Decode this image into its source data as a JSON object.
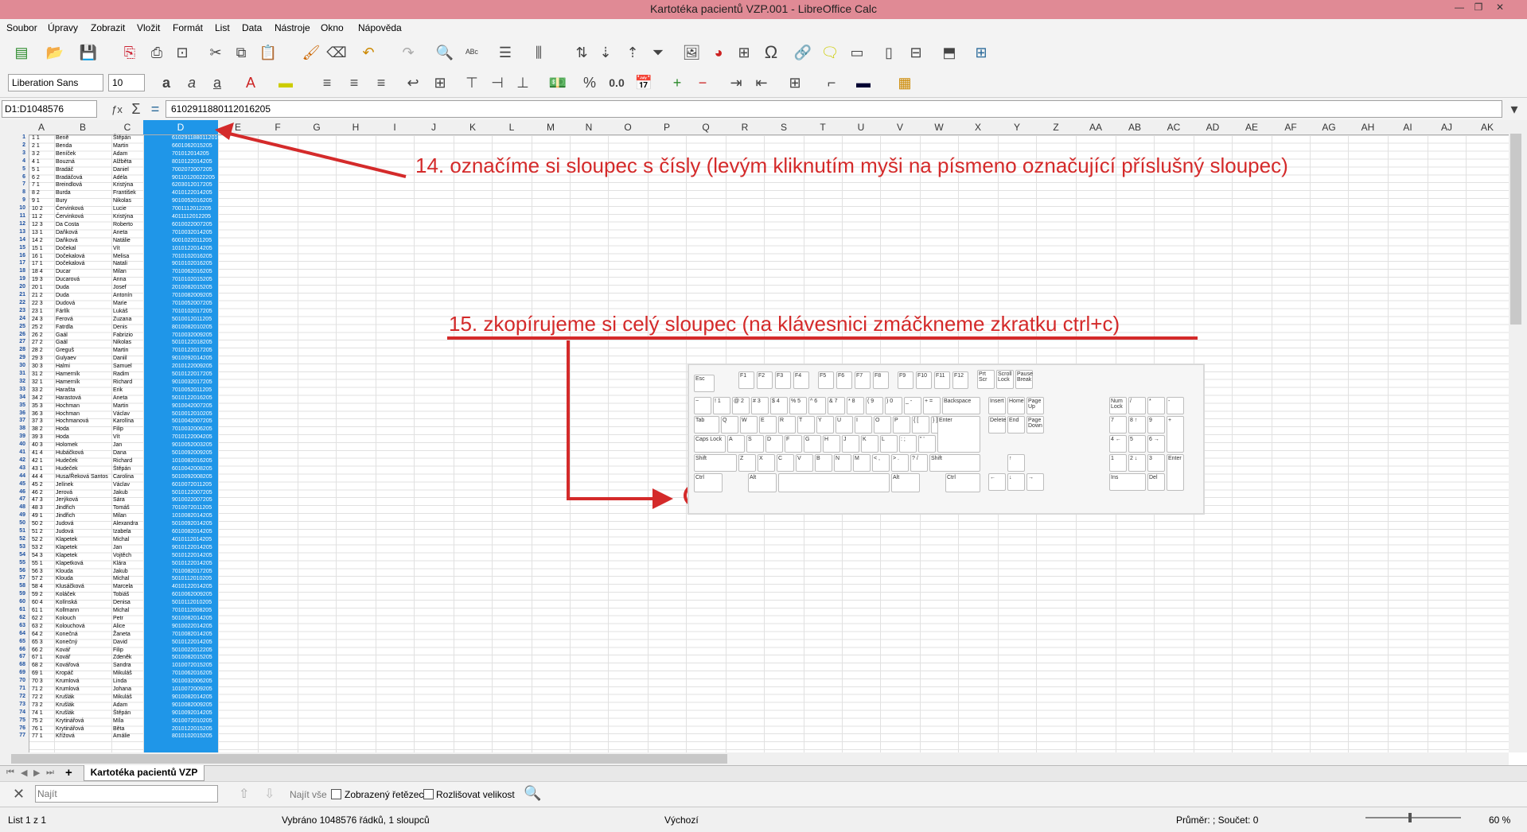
{
  "window": {
    "title": "Kartotéka pacientů VZP.001 - LibreOffice Calc"
  },
  "menu": [
    "Soubor",
    "Úpravy",
    "Zobrazit",
    "Vložit",
    "Formát",
    "List",
    "Data",
    "Nástroje",
    "Okno",
    "Nápověda"
  ],
  "toolbar": {
    "font_name": "Liberation Sans",
    "font_size": "10"
  },
  "formula_bar": {
    "name_box": "D1:D1048576",
    "content": "6102911880112016205"
  },
  "columns": [
    "A",
    "B",
    "C",
    "D",
    "E",
    "F",
    "G",
    "H",
    "I",
    "J",
    "K",
    "L",
    "M",
    "N",
    "O",
    "P",
    "Q",
    "R",
    "S",
    "T",
    "U",
    "V",
    "W",
    "X",
    "Y",
    "Z",
    "AA",
    "AB",
    "AC",
    "AD",
    "AE",
    "AF",
    "AG",
    "AH",
    "AI",
    "AJ",
    "AK"
  ],
  "rows": [
    "1",
    "2",
    "3",
    "4",
    "5",
    "6",
    "7",
    "8",
    "9",
    "10",
    "11",
    "12",
    "13",
    "14",
    "15",
    "16",
    "17",
    "18",
    "19",
    "20",
    "21",
    "22",
    "23",
    "24",
    "25",
    "26",
    "27",
    "28",
    "29",
    "30",
    "31",
    "32",
    "33",
    "34",
    "35",
    "36",
    "37",
    "38",
    "39",
    "40",
    "41",
    "42",
    "43",
    "44",
    "45",
    "46",
    "47",
    "48",
    "49",
    "50",
    "51",
    "52",
    "53",
    "54",
    "55",
    "56",
    "57",
    "58",
    "59",
    "60",
    "61",
    "62",
    "63",
    "64",
    "65",
    "66",
    "67",
    "68",
    "69",
    "70",
    "71",
    "72",
    "73",
    "74",
    "75",
    "76",
    "77"
  ],
  "names": [
    [
      "1 1",
      "Beně",
      "Štěpán"
    ],
    [
      "2 1",
      "Benda",
      "Martin"
    ],
    [
      "3 2",
      "Beníček",
      "Adam"
    ],
    [
      "4 1",
      "Bouzná",
      "Alžběta"
    ],
    [
      "5 1",
      "Bradáč",
      "Daniel"
    ],
    [
      "6 2",
      "Bradáčová",
      "Adéla"
    ],
    [
      "7 1",
      "Breindlová",
      "Kristýna"
    ],
    [
      "8 2",
      "Burda",
      "František"
    ],
    [
      "9 1",
      "Bury",
      "Nikolas"
    ],
    [
      "10 2",
      "Červinková",
      "Lucie"
    ],
    [
      "11 2",
      "Červinková",
      "Kristýna"
    ],
    [
      "12 3",
      "Da Costa",
      "Roberto"
    ],
    [
      "13 1",
      "Daňková",
      "Aneta"
    ],
    [
      "14 2",
      "Daňková",
      "Natálie"
    ],
    [
      "15 1",
      "Dočekal",
      "Vít"
    ],
    [
      "16 1",
      "Dočekalová",
      "Melisa"
    ],
    [
      "17 1",
      "Dočekalová",
      "Natali"
    ],
    [
      "18 4",
      "Ducar",
      "Milan"
    ],
    [
      "19 3",
      "Ducarová",
      "Anna"
    ],
    [
      "20 1",
      "Duda",
      "Josef"
    ],
    [
      "21 2",
      "Duda",
      "Antonín"
    ],
    [
      "22 3",
      "Dudová",
      "Marie"
    ],
    [
      "23 1",
      "Fárlík",
      "Lukáš"
    ],
    [
      "24 3",
      "Ferová",
      "Zuzana"
    ],
    [
      "25 2",
      "Fatrdla",
      "Denis"
    ],
    [
      "26 2",
      "Gaál",
      "Fabrizio"
    ],
    [
      "27 2",
      "Gaál",
      "Nikolas"
    ],
    [
      "28 2",
      "Greguš",
      "Martin"
    ],
    [
      "29 3",
      "Gulyaev",
      "Daniil"
    ],
    [
      "30 3",
      "Halmi",
      "Samuel"
    ],
    [
      "31 2",
      "Hamerník",
      "Radim"
    ],
    [
      "32 1",
      "Hamerník",
      "Richard"
    ],
    [
      "33 2",
      "Harašta",
      "Erik"
    ],
    [
      "34 2",
      "Harastová",
      "Aneta"
    ],
    [
      "35 3",
      "Hochman",
      "Martin"
    ],
    [
      "36 3",
      "Hochman",
      "Václav"
    ],
    [
      "37 3",
      "Hochmanová",
      "Karolína"
    ],
    [
      "38 2",
      "Hoda",
      "Filip"
    ],
    [
      "39 3",
      "Hoda",
      "Vít"
    ],
    [
      "40 3",
      "Holomek",
      "Jan"
    ],
    [
      "41 4",
      "Hubáčková",
      "Dana"
    ],
    [
      "42 1",
      "Hudeček",
      "Richard"
    ],
    [
      "43 1",
      "Hudeček",
      "Štěpán"
    ],
    [
      "44 4",
      "Husa/Řeková Santos",
      "Carolina"
    ],
    [
      "45 2",
      "Jelínek",
      "Václav"
    ],
    [
      "46 2",
      "Jerová",
      "Jakub"
    ],
    [
      "47 3",
      "Jerýková",
      "Sára"
    ],
    [
      "48 3",
      "Jindřich",
      "Tomáš"
    ],
    [
      "49 1",
      "Jindřich",
      "Milan"
    ],
    [
      "50 2",
      "Judová",
      "Alexandra"
    ],
    [
      "51 2",
      "Judová",
      "Izabela"
    ],
    [
      "52 2",
      "Klapetek",
      "Michal"
    ],
    [
      "53 2",
      "Klapetek",
      "Jan"
    ],
    [
      "54 3",
      "Klapetek",
      "Vojtěch"
    ],
    [
      "55 1",
      "Klapetková",
      "Klára"
    ],
    [
      "56 3",
      "Klouda",
      "Jakub"
    ],
    [
      "57 2",
      "Klouda",
      "Michal"
    ],
    [
      "58 4",
      "Klusáčková",
      "Marcela"
    ],
    [
      "59 2",
      "Koláček",
      "Tobiáš"
    ],
    [
      "60 4",
      "Kolínská",
      "Denisa"
    ],
    [
      "61 1",
      "Kollmann",
      "Michal"
    ],
    [
      "62 2",
      "Kolouch",
      "Petr"
    ],
    [
      "63 2",
      "Kolouchová",
      "Alice"
    ],
    [
      "64 2",
      "Konečná",
      "Žaneta"
    ],
    [
      "65 3",
      "Konečný",
      "David"
    ],
    [
      "66 2",
      "Kovář",
      "Filip"
    ],
    [
      "67 1",
      "Kovář",
      "Zdeněk"
    ],
    [
      "68 2",
      "Kovářová",
      "Sandra"
    ],
    [
      "69 1",
      "Kropáč",
      "Mikuláš"
    ],
    [
      "70 3",
      "Krumlová",
      "Linda"
    ],
    [
      "71 2",
      "Krumlová",
      "Johana"
    ],
    [
      "72 2",
      "Krušlák",
      "Mikuláš"
    ],
    [
      "73 2",
      "Krušlák",
      "Adam"
    ],
    [
      "74 1",
      "Krušlák",
      "Štěpán"
    ],
    [
      "75 2",
      "Krytinářová",
      "Míla"
    ],
    [
      "76 1",
      "Krytinářová",
      "Běta"
    ],
    [
      "77 1",
      "Křížová",
      "Amálie"
    ]
  ],
  "col_d_values": [
    "6102911880112016205",
    "6601062015205",
    "701012014205",
    "8010122014205",
    "7002072007205",
    "90110120022205",
    "6203012017205",
    "4010122014205",
    "9010052016205",
    "7001112012205",
    "4011112012205",
    "6010022007205",
    "7010032014205",
    "6001022011205",
    "1010122014205",
    "7010102016205",
    "9010102016205",
    "7010062016205",
    "7010102015205",
    "2010082015205",
    "7010082009205",
    "7010052007205",
    "7010102017205",
    "5010012011205",
    "8010082010205",
    "7010032009205",
    "5010122018205",
    "7010122017205",
    "9010092014205",
    "2010122009205",
    "5010122017205",
    "9010032017205",
    "7010052011205",
    "5010122016205",
    "9010042007205",
    "5010012010205",
    "5010042007205",
    "7010032006205",
    "7010122004205",
    "9010052003205",
    "5010092009205",
    "1010082016205",
    "6010042008205",
    "5010092008205",
    "6010072011205",
    "5010122007205",
    "9010022007205",
    "7010072011205",
    "1010082014205",
    "5010092014205",
    "6010082014205",
    "4010112014205",
    "9010122014205",
    "5010122014205",
    "5010122014205",
    "7010082017205",
    "5010112010205",
    "4010122014205",
    "6010062009205",
    "5010112010205",
    "7010112008205",
    "5010082014205",
    "9010022014205",
    "7010082014205",
    "5010122014205",
    "5010022012205",
    "5010082015205",
    "1010072015205",
    "7010062016205",
    "5010032006205",
    "1010072009205",
    "9010082014205",
    "9010082009205",
    "9010092014205",
    "5010072010205",
    "2010122015205",
    "8010102015205"
  ],
  "annotations": {
    "step14": "14. označíme si sloupec s čísly (levým kliknutím myši na písmeno označující příslušný sloupec)",
    "step15": "15. zkopírujeme si celý sloupec (na klávesnici zmáčkneme zkratku ctrl+c)"
  },
  "keyboard_labels": {
    "esc": "Esc",
    "ctrl": "Ctrl",
    "v": "V",
    "alt": "Alt",
    "altgr": "Alt",
    "shift": "Shift",
    "enter": "Enter",
    "caps": "Caps Lock",
    "tab": "Tab",
    "backspace": "Backspace",
    "f1": "F1",
    "f2": "F2",
    "f3": "F3",
    "f4": "F4",
    "f5": "F5",
    "f6": "F6",
    "f7": "F7",
    "f8": "F8",
    "f9": "F9",
    "f10": "F10",
    "f11": "F11",
    "f12": "F12",
    "prtscr": "Prt Scr",
    "scroll": "Scroll Lock",
    "pause": "Pause Break",
    "insert": "Insert",
    "home": "Home",
    "pageup": "Page Up",
    "delete": "Delete",
    "end": "End",
    "pagedown": "Page Down",
    "numlock": "Num Lock",
    "ins": "Ins",
    "del": "Del"
  },
  "sheet_tab": "Kartotéka pacientů VZP",
  "findbar": {
    "placeholder": "Najít",
    "find_all": "Najít vše",
    "displayed_string": "Zobrazený řetězec",
    "match_case": "Rozlišovat velikost"
  },
  "status": {
    "sheet": "List 1 z 1",
    "selection": "Vybráno 1048576 řádků, 1 sloupců",
    "style": "Výchozí",
    "sum": "Průměr: ; Součet: 0",
    "zoom": "60 %"
  },
  "colors": {
    "title": "#e08a95",
    "selection": "#1f96e8",
    "annotation": "#d42a2a"
  }
}
